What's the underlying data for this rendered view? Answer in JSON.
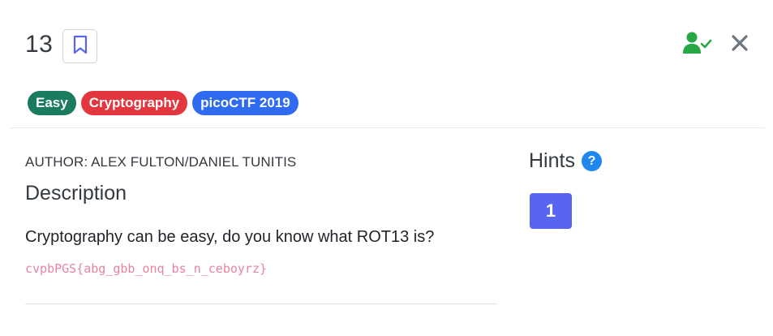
{
  "challenge": {
    "title": "13",
    "author": "AUTHOR: ALEX FULTON/DANIEL TUNITIS",
    "description_heading": "Description",
    "description": "Cryptography can be easy, do you know what ROT13 is?",
    "ciphertext": "cvpbPGS{abg_gbb_onq_bs_n_ceboyrz}"
  },
  "tags": [
    {
      "label": "Easy",
      "color": "#1a7b5e"
    },
    {
      "label": "Cryptography",
      "color": "#e4363f"
    },
    {
      "label": "picoCTF 2019",
      "color": "#2f6bf0"
    }
  ],
  "icons": {
    "bookmark": "bookmark-icon",
    "solved": "user-check-icon",
    "close": "close-icon",
    "help": "question-circle-icon"
  },
  "hints": {
    "title": "Hints",
    "help_glyph": "?",
    "buttons": [
      "1"
    ]
  },
  "colors": {
    "accent": "#5865f2",
    "solved_green": "#28a745",
    "close_gray": "#6c757d",
    "cipher_pink": "#e8839f"
  }
}
